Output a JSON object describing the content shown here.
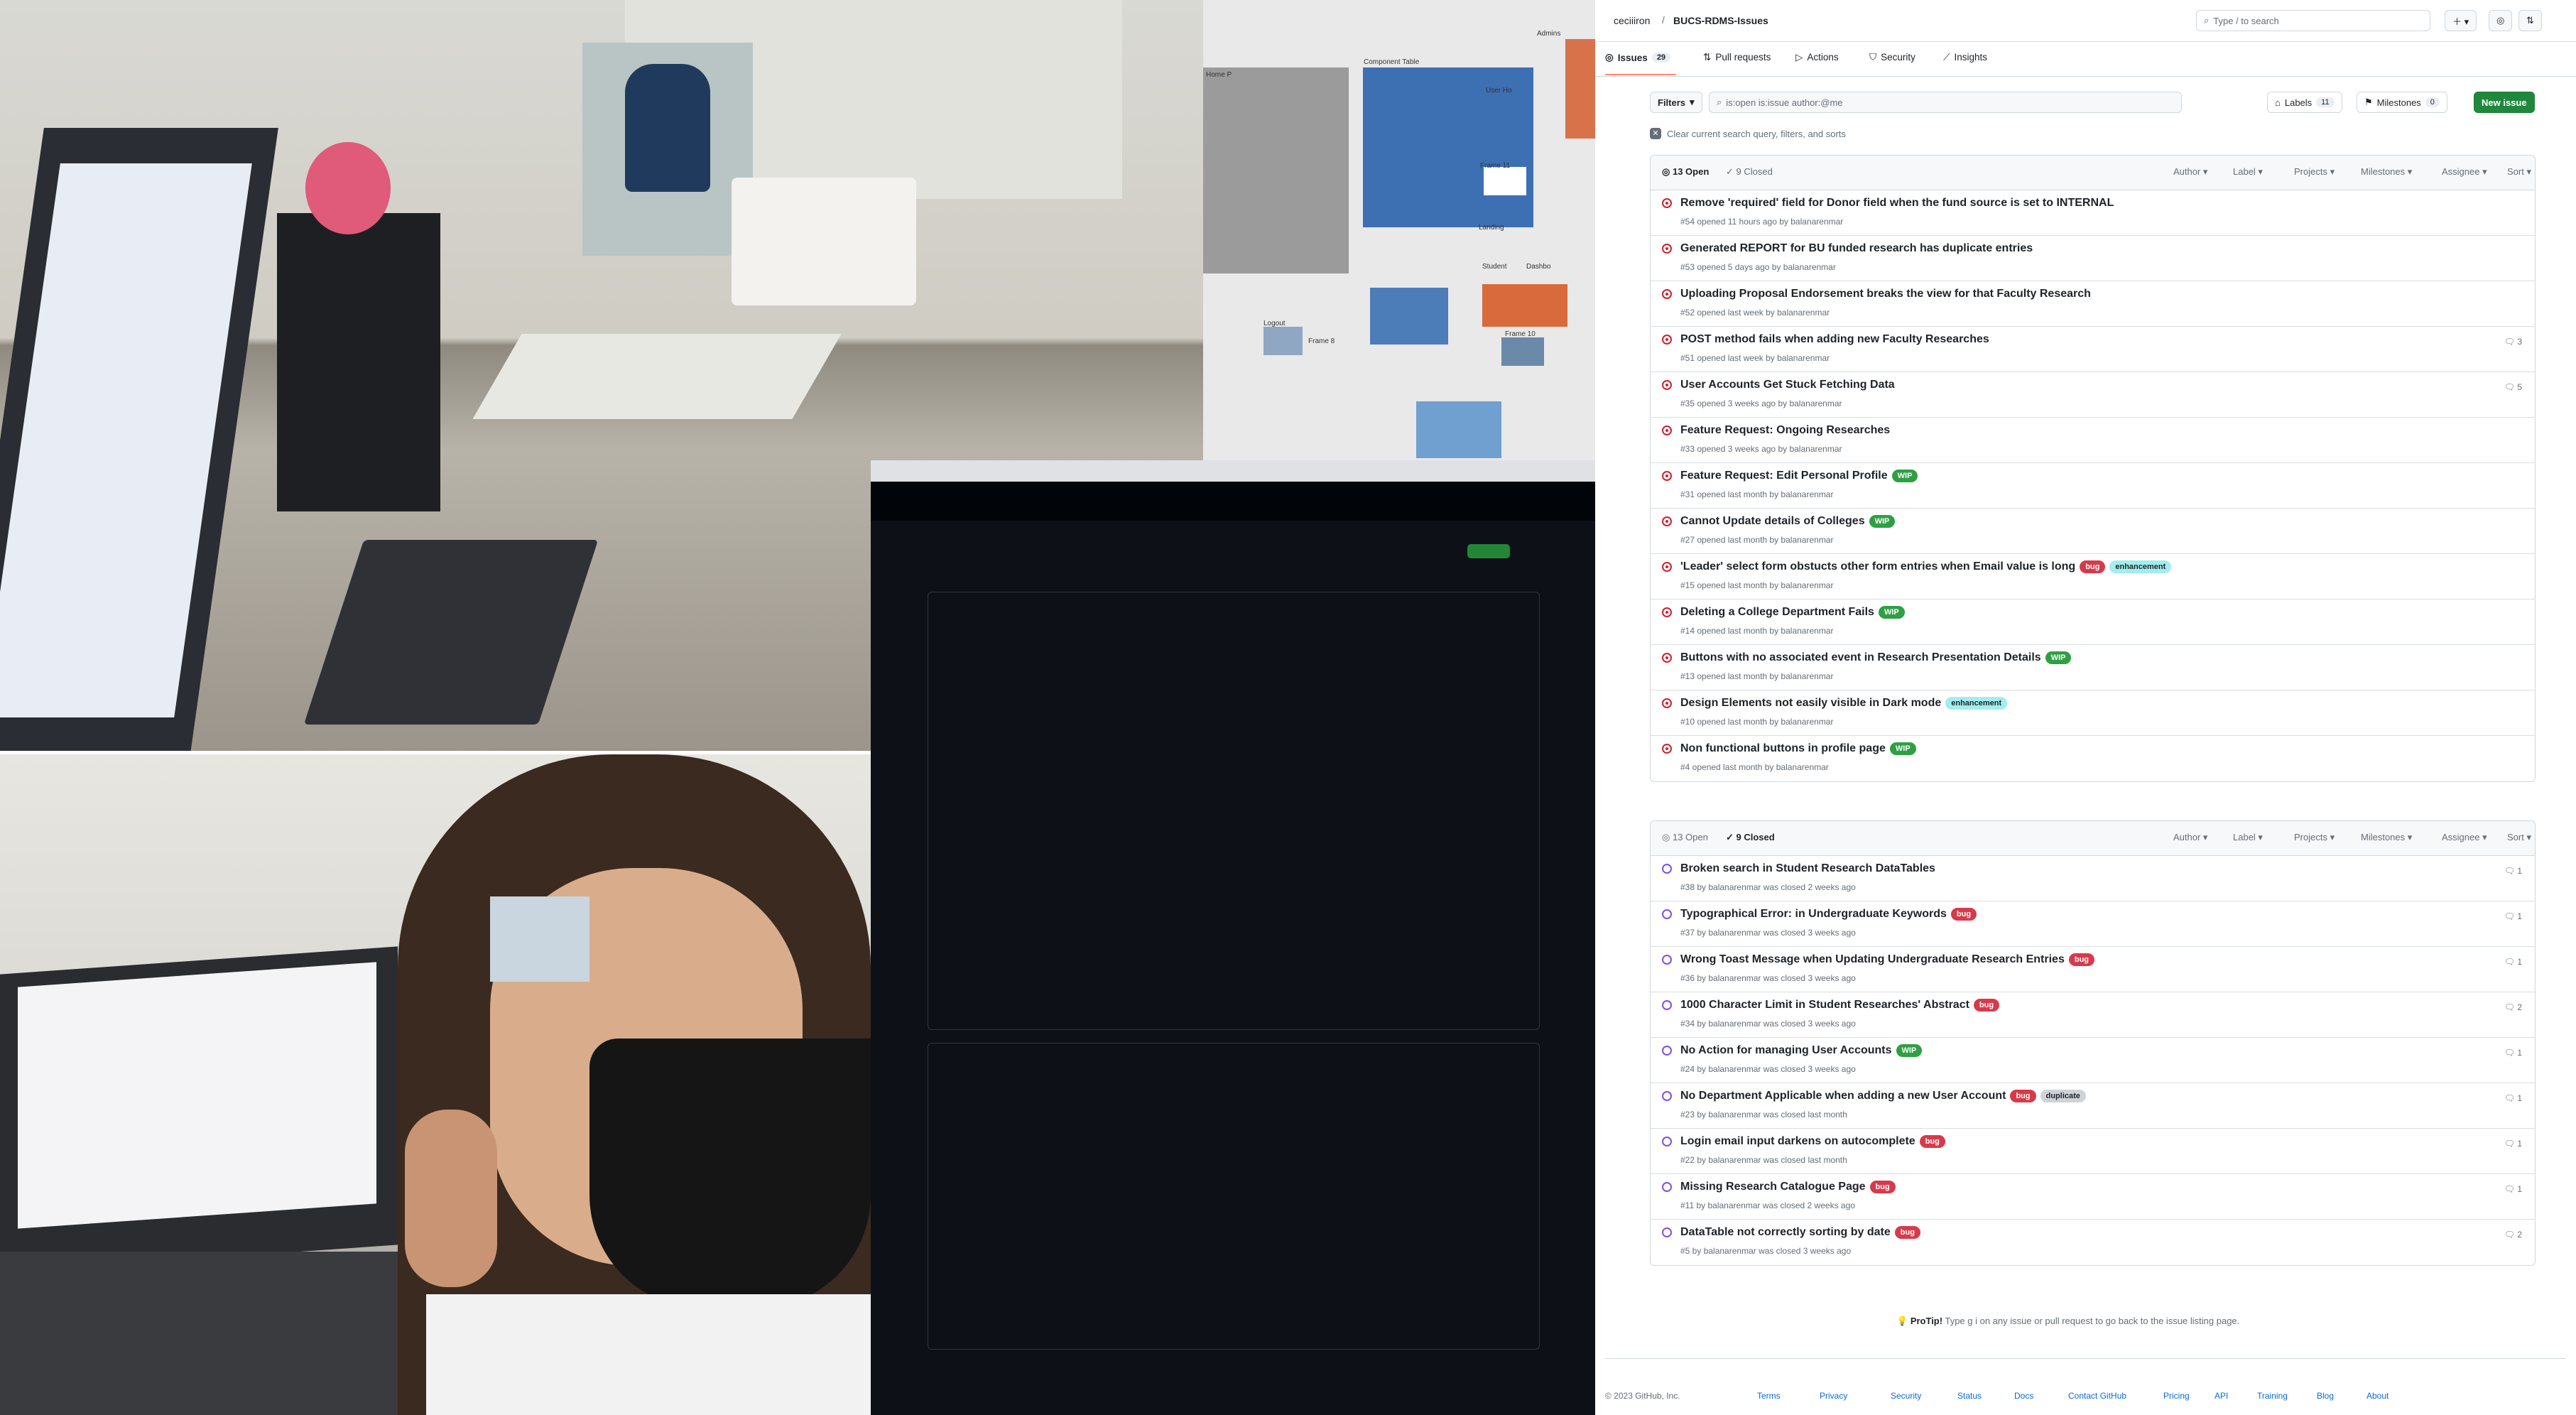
{
  "repo": {
    "owner": "ceciiiron",
    "name": "BUCS-RDMS-Issues"
  },
  "search": {
    "placeholder": "Type / to search"
  },
  "tabs": [
    {
      "label": "Issues",
      "count": "29"
    },
    {
      "label": "Pull requests"
    },
    {
      "label": "Actions"
    },
    {
      "label": "Security"
    },
    {
      "label": "Insights"
    }
  ],
  "toolbar": {
    "filters": "Filters",
    "query": "is:open is:issue author:@me",
    "labels": "Labels",
    "labels_count": "11",
    "milestones": "Milestones",
    "milestones_count": "0",
    "new_issue": "New issue",
    "clear": "Clear current search query, filters, and sorts"
  },
  "list_header": {
    "open": "13 Open",
    "closed": "9 Closed",
    "filters": [
      "Author",
      "Label",
      "Projects",
      "Milestones",
      "Assignee",
      "Sort"
    ]
  },
  "open_issues": [
    {
      "title": "Remove 'required' field for Donor field when the fund source is set to INTERNAL",
      "meta": "#54 opened 11 hours ago by balanarenmar",
      "labels": [],
      "comments": ""
    },
    {
      "title": "Generated REPORT for BU funded research has duplicate entries",
      "meta": "#53 opened 5 days ago by balanarenmar",
      "labels": [],
      "comments": ""
    },
    {
      "title": "Uploading Proposal Endorsement breaks the view for that Faculty Research",
      "meta": "#52 opened last week by balanarenmar",
      "labels": [],
      "comments": ""
    },
    {
      "title": "POST method fails when adding new Faculty Researches",
      "meta": "#51 opened last week by balanarenmar",
      "labels": [],
      "comments": "3"
    },
    {
      "title": "User Accounts Get Stuck Fetching Data",
      "meta": "#35 opened 3 weeks ago by balanarenmar",
      "labels": [],
      "comments": "5"
    },
    {
      "title": "Feature Request: Ongoing Researches",
      "meta": "#33 opened 3 weeks ago by balanarenmar",
      "labels": [],
      "comments": ""
    },
    {
      "title": "Feature Request: Edit Personal Profile",
      "meta": "#31 opened last month by balanarenmar",
      "labels": [
        "WIP"
      ],
      "comments": ""
    },
    {
      "title": "Cannot Update details of Colleges",
      "meta": "#27 opened last month by balanarenmar",
      "labels": [
        "WIP"
      ],
      "comments": ""
    },
    {
      "title": "'Leader' select form obstucts other form entries when Email value is long",
      "meta": "#15 opened last month by balanarenmar",
      "labels": [
        "bug",
        "enhancement"
      ],
      "comments": ""
    },
    {
      "title": "Deleting a College Department Fails",
      "meta": "#14 opened last month by balanarenmar",
      "labels": [
        "WIP"
      ],
      "comments": ""
    },
    {
      "title": "Buttons with no associated event in Research Presentation Details",
      "meta": "#13 opened last month by balanarenmar",
      "labels": [
        "WIP"
      ],
      "comments": ""
    },
    {
      "title": "Design Elements not easily visible in Dark mode",
      "meta": "#10 opened last month by balanarenmar",
      "labels": [
        "enhancement"
      ],
      "comments": ""
    },
    {
      "title": "Non functional buttons in profile page",
      "meta": "#4 opened last month by balanarenmar",
      "labels": [
        "WIP"
      ],
      "comments": ""
    }
  ],
  "closed_issues": [
    {
      "title": "Broken search in Student Research DataTables",
      "meta": "#38 by balanarenmar was closed 2 weeks ago",
      "labels": [],
      "comments": "1"
    },
    {
      "title": "Typographical Error: in Undergraduate Keywords",
      "meta": "#37 by balanarenmar was closed 3 weeks ago",
      "labels": [
        "bug"
      ],
      "comments": "1"
    },
    {
      "title": "Wrong Toast Message when Updating Undergraduate Research Entries",
      "meta": "#36 by balanarenmar was closed 3 weeks ago",
      "labels": [
        "bug"
      ],
      "comments": "1"
    },
    {
      "title": "1000 Character Limit in Student Researches' Abstract",
      "meta": "#34 by balanarenmar was closed 3 weeks ago",
      "labels": [
        "bug"
      ],
      "comments": "2"
    },
    {
      "title": "No Action for managing User Accounts",
      "meta": "#24 by balanarenmar was closed 3 weeks ago",
      "labels": [
        "WIP"
      ],
      "comments": "1"
    },
    {
      "title": "No Department Applicable when adding a new User Account",
      "meta": "#23 by balanarenmar was closed last month",
      "labels": [
        "bug",
        "duplicate"
      ],
      "comments": "1"
    },
    {
      "title": "Login email input darkens on autocomplete",
      "meta": "#22 by balanarenmar was closed last month",
      "labels": [
        "bug"
      ],
      "comments": "1"
    },
    {
      "title": "Missing Research Catalogue Page",
      "meta": "#11 by balanarenmar was closed 2 weeks ago",
      "labels": [
        "bug"
      ],
      "comments": "1"
    },
    {
      "title": "DataTable not correctly sorting by date",
      "meta": "#5 by balanarenmar was closed 3 weeks ago",
      "labels": [
        "bug"
      ],
      "comments": "2"
    }
  ],
  "label_colors": {
    "WIP": "#2ea043",
    "bug": "#d73a4a",
    "enhancement": "#a2eeef",
    "duplicate": "#cfd3d7"
  },
  "protip": {
    "prefix": "ProTip!",
    "text": "Type g i on any issue or pull request to go back to the issue listing page."
  },
  "footer": {
    "copyright": "© 2023 GitHub, Inc.",
    "links": [
      "Terms",
      "Privacy",
      "Security",
      "Status",
      "Docs",
      "Contact GitHub",
      "Pricing",
      "API",
      "Training",
      "Blog",
      "About"
    ]
  },
  "figma_frames": [
    "Component Table",
    "Home P",
    "Admins",
    "User Ho",
    "Frame 11",
    "Landing",
    "Student",
    "Dashbo",
    "Logout",
    "Frame 8",
    "Frame 10"
  ]
}
